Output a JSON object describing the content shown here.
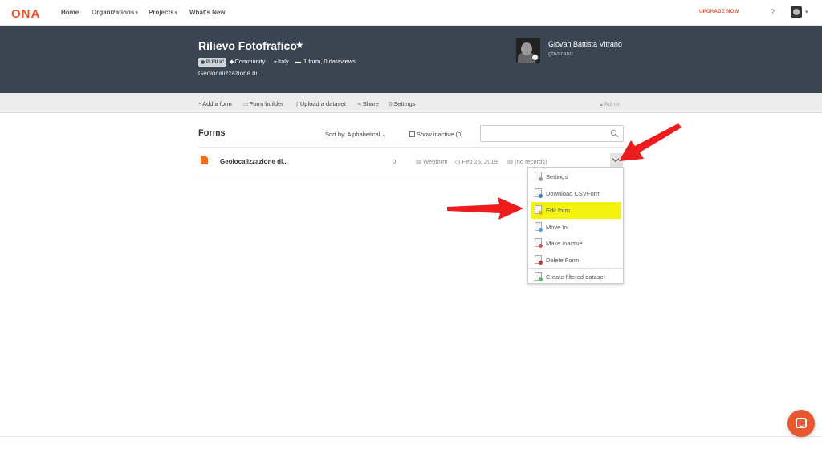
{
  "nav": {
    "logo": "ONA",
    "links": [
      "Home",
      "Organizations",
      "Projects",
      "What's New"
    ],
    "upgrade": "UPGRADE NOW",
    "help": "?"
  },
  "project": {
    "title": "Rilievo Fotofrafico",
    "visibility": "PUBLIC",
    "category": "Community",
    "location": "Italy",
    "summary": "1 form, 0 dataviews",
    "description": "Geolocalizzazione di..."
  },
  "owner": {
    "name": "Giovan Battista Vitrano",
    "username": "gbvitrano"
  },
  "toolbar": {
    "add_form": "Add a form",
    "form_builder": "Form builder",
    "upload": "Upload a dataset",
    "share": "Share",
    "settings": "Settings",
    "admin": "Admin"
  },
  "forms": {
    "title": "Forms",
    "sort_by": "Sort by: Alphabetical",
    "show_inactive": "Show inactive (0)",
    "search_placeholder": "",
    "rows": [
      {
        "name": "Geolocalizzazione di...",
        "count": "0",
        "type": "Webform",
        "date": "Feb 26, 2019",
        "records": "(no records)"
      }
    ]
  },
  "dropdown": {
    "items": [
      "Settings",
      "Download CSVForm",
      "Edit form",
      "Move to...",
      "Make inactive",
      "Delete Form",
      "Create filtered dataset"
    ],
    "highlight_color": "#f3f30f"
  },
  "colors": {
    "accent": "#e8572e",
    "header_bg": "#3b4451",
    "arrow": "#ee1c1c"
  }
}
